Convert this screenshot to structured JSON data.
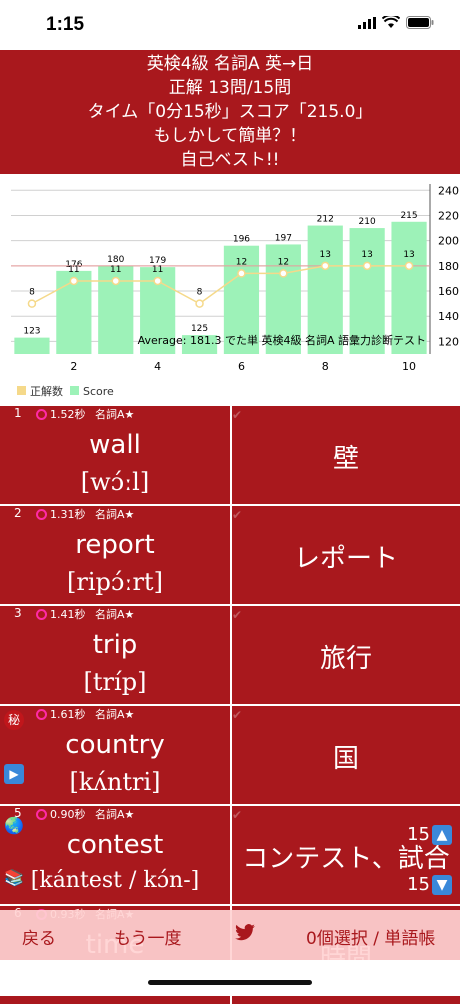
{
  "status": {
    "time": "1:15"
  },
  "header": {
    "line1": "英検4級 名詞A 英→日",
    "line2": "正解 13問/15問",
    "line3": "タイム「0分15秒」スコア「215.0」",
    "line4": "もしかして簡単？！",
    "line5": "自己ベスト!!"
  },
  "chart_data": {
    "type": "bar",
    "x": [
      1,
      2,
      3,
      4,
      5,
      6,
      7,
      8,
      9,
      10
    ],
    "x_ticks": [
      "2",
      "4",
      "6",
      "8",
      "10"
    ],
    "y_ticks": [
      "120",
      "140",
      "160",
      "180",
      "200",
      "220",
      "240"
    ],
    "ylim": [
      110,
      245
    ],
    "series": [
      {
        "name": "Score",
        "type": "bar",
        "values": [
          123,
          176,
          180,
          179,
          125,
          196,
          197,
          212,
          210,
          215
        ],
        "color": "#9df2b8"
      },
      {
        "name": "正解数",
        "type": "line",
        "values": [
          8,
          11,
          11,
          11,
          8,
          12,
          12,
          13,
          13,
          13
        ],
        "color": "#f5d98a"
      }
    ],
    "reference_line": 180,
    "annotation": "Average: 181.3 でた単 英検4級 名詞A 語彙力診断テスト",
    "legend": [
      "正解数",
      "Score"
    ],
    "legend_position": "bottom-left"
  },
  "rows": [
    {
      "num": "1",
      "time": "1.52秒",
      "tag": "名詞A★",
      "word": "wall",
      "pron": "[wɔ́ːl]",
      "meaning": "壁"
    },
    {
      "num": "2",
      "time": "1.31秒",
      "tag": "名詞A★",
      "word": "report",
      "pron": "[ripɔ́ːrt]",
      "meaning": "レポート"
    },
    {
      "num": "3",
      "time": "1.41秒",
      "tag": "名詞A★",
      "word": "trip",
      "pron": "[tríp]",
      "meaning": "旅行"
    },
    {
      "num": "4",
      "time": "1.61秒",
      "tag": "名詞A★",
      "word": "country",
      "pron": "[kʌ́ntri]",
      "meaning": "国"
    },
    {
      "num": "5",
      "time": "0.90秒",
      "tag": "名詞A★",
      "word": "contest",
      "pron": "[kántest / kɔ́n-]",
      "meaning": "コンテスト、試合"
    },
    {
      "num": "6",
      "time": "0.93秒",
      "tag": "名詞A★",
      "word": "time",
      "pron": "",
      "meaning": "時間"
    }
  ],
  "side_icons": {
    "secret": "秘",
    "play": "▶",
    "globe": "🌏",
    "books": "📚"
  },
  "counters": {
    "up": "15",
    "down": "15"
  },
  "toolbar": {
    "back": "戻る",
    "again": "もう一度",
    "selection": "0個選択 / 単語帳"
  }
}
